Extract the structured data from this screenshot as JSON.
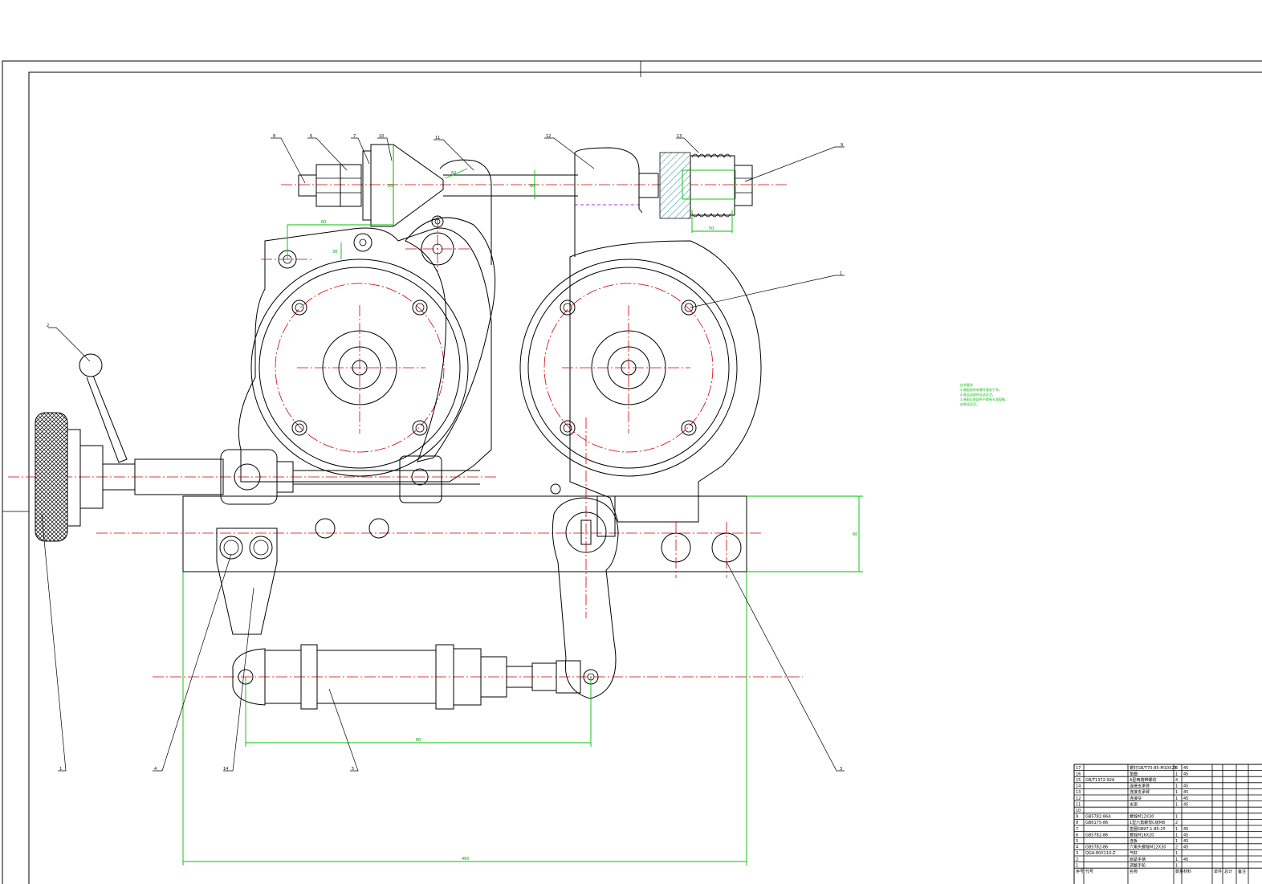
{
  "drawing": {
    "balloons": [
      "8",
      "6",
      "7",
      "10",
      "11",
      "12",
      "13",
      "9",
      "2",
      "1",
      "4",
      "14",
      "5",
      "3"
    ],
    "dimension_texts": [
      "80",
      "60",
      "20",
      "60",
      "60",
      "40",
      "50",
      "60",
      "40",
      "50",
      "60",
      "30",
      "460"
    ],
    "notes": {
      "title": "技术要求",
      "lines": [
        "1.装配前所有零件清洗干净。",
        "2.各运动部件运动灵活。",
        "3.装配后各部件不得有卡滞现象，",
        "  应转动灵活。"
      ]
    },
    "bom_rows": [
      {
        "no": "17",
        "code": "",
        "name": "螺钉GB/T70-85-M10X25",
        "qty": "6",
        "mat": "45"
      },
      {
        "no": "16",
        "code": "",
        "name": "垫圈",
        "qty": "1",
        "mat": "45"
      },
      {
        "no": "15",
        "code": "GB/T1372-92A",
        "name": "A型两端带螺纹",
        "qty": "4",
        "mat": ""
      },
      {
        "no": "14",
        "code": "",
        "name": "连接支承臂",
        "qty": "1",
        "mat": "45"
      },
      {
        "no": "13",
        "code": "",
        "name": "连接支承臂",
        "qty": "1",
        "mat": "45"
      },
      {
        "no": "12",
        "code": "",
        "name": "连接块",
        "qty": "1",
        "mat": "45"
      },
      {
        "no": "11",
        "code": "",
        "name": "支架",
        "qty": "1",
        "mat": "45"
      },
      {
        "no": "10",
        "code": "",
        "name": "",
        "qty": "",
        "mat": ""
      },
      {
        "no": "9",
        "code": "GB5782-86A",
        "name": "螺栓M12X30",
        "qty": "1",
        "mat": ""
      },
      {
        "no": "8",
        "code": "GB6175-86",
        "name": "1型六角螺母C级M8",
        "qty": "2",
        "mat": ""
      },
      {
        "no": "7",
        "code": "",
        "name": "垫圈GB97.1-85-25",
        "qty": "1",
        "mat": "45"
      },
      {
        "no": "6",
        "code": "GB5782-86",
        "name": "螺栓M16X20",
        "qty": "1",
        "mat": "45"
      },
      {
        "no": "5",
        "code": "",
        "name": "连板",
        "qty": "1",
        "mat": "45"
      },
      {
        "no": "4",
        "code": "GB5782-86",
        "name": "六角头螺栓M12X30",
        "qty": "2",
        "mat": "45"
      },
      {
        "no": "3",
        "code": "QGA-80X110-Z",
        "name": "气缸",
        "qty": "1",
        "mat": ""
      },
      {
        "no": "2",
        "code": "",
        "name": "锁紧手柄",
        "qty": "1",
        "mat": "45"
      },
      {
        "no": "1",
        "code": "",
        "name": "调整手轮",
        "qty": "1",
        "mat": ""
      }
    ],
    "bom_header": [
      "序号",
      "代号",
      "名称",
      "数量",
      "材料",
      "单件",
      "总计",
      "备注"
    ]
  }
}
